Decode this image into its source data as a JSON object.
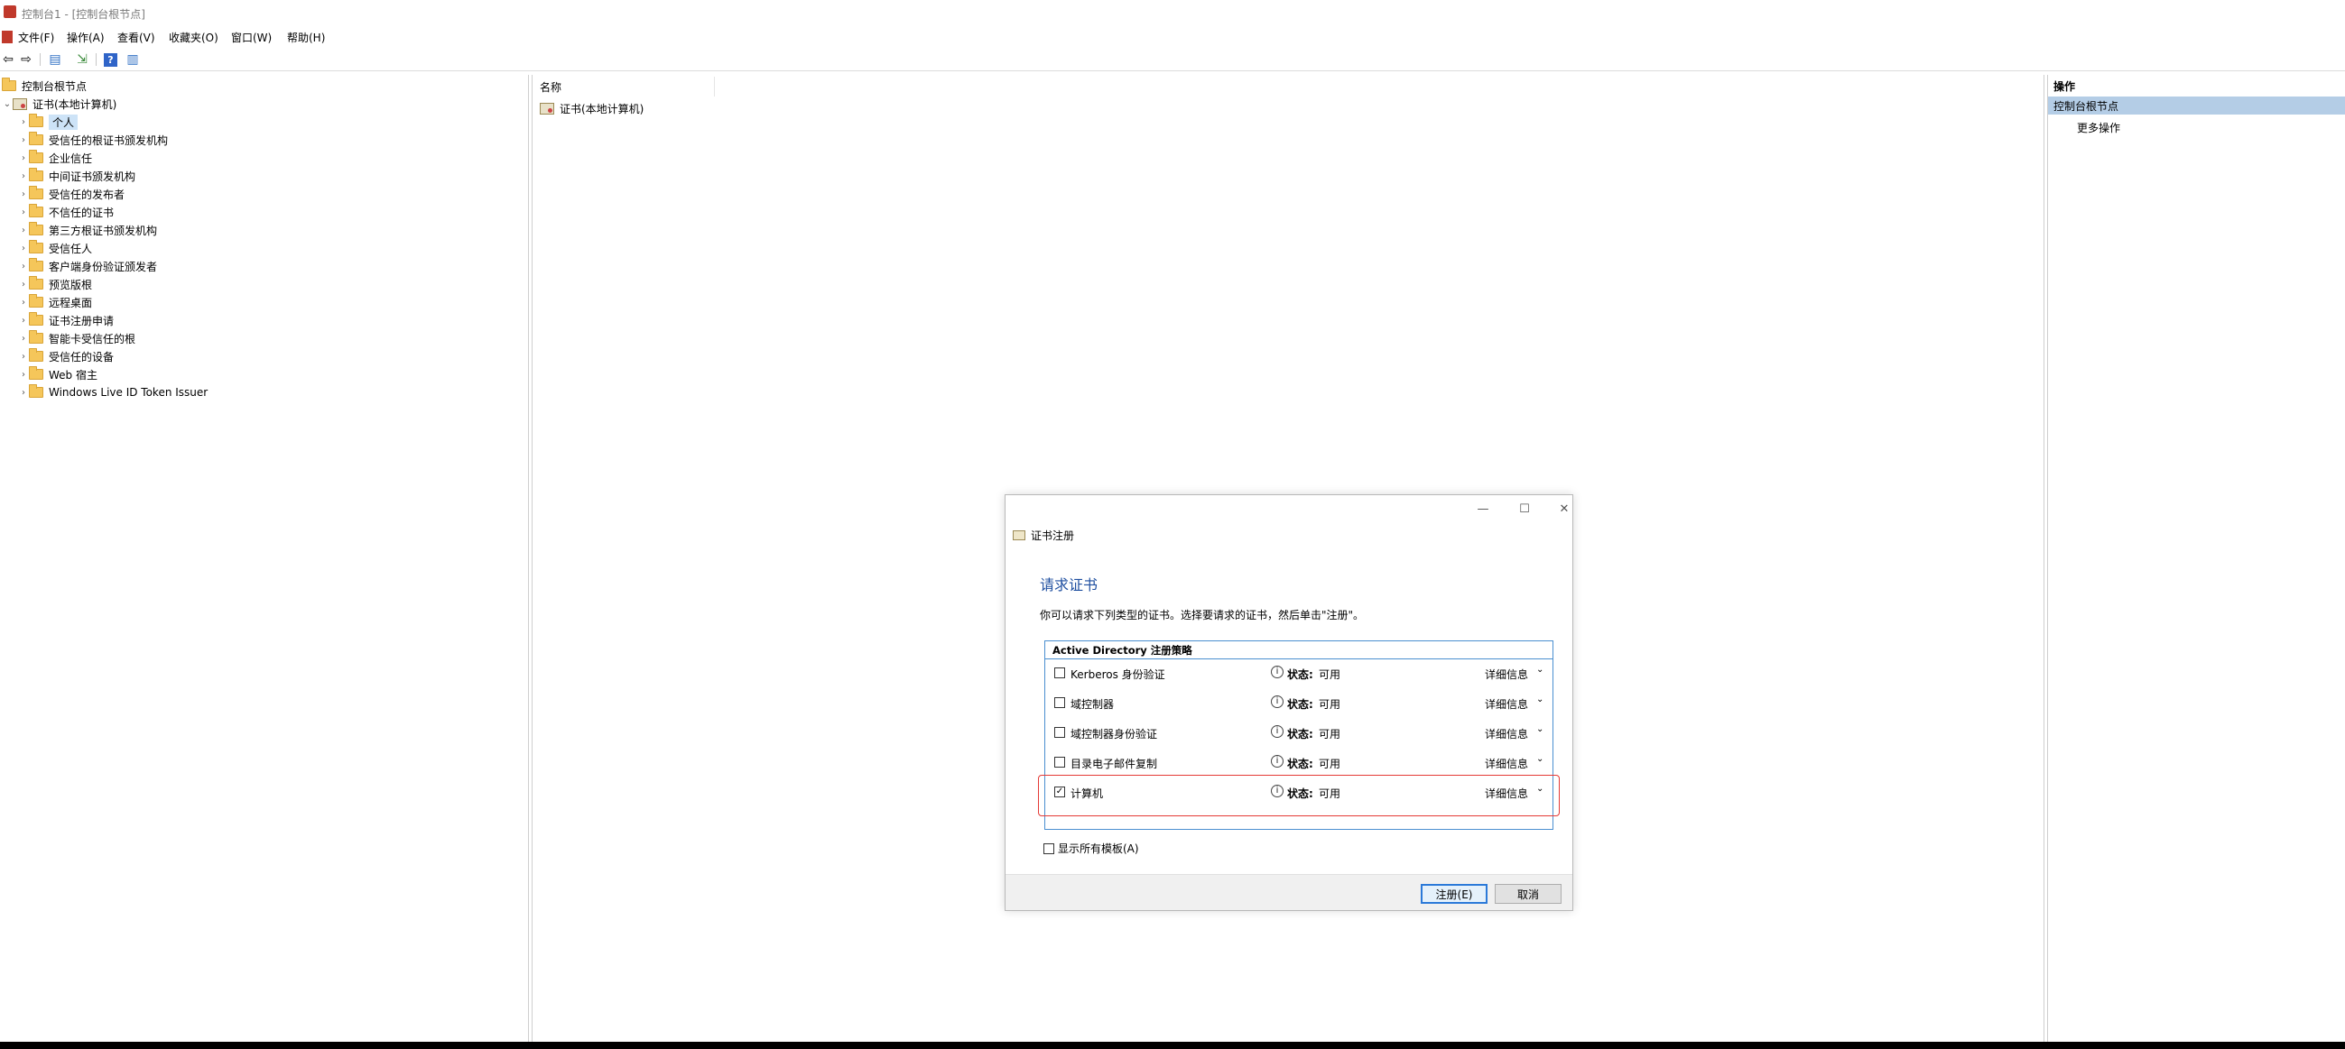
{
  "window": {
    "title": "控制台1 - [控制台根节点]"
  },
  "menu": [
    "文件(F)",
    "操作(A)",
    "查看(V)",
    "收藏夹(O)",
    "窗口(W)",
    "帮助(H)"
  ],
  "tree": {
    "root": "控制台根节点",
    "cert_root": "证书(本地计算机)",
    "items": [
      "个人",
      "受信任的根证书颁发机构",
      "企业信任",
      "中间证书颁发机构",
      "受信任的发布者",
      "不信任的证书",
      "第三方根证书颁发机构",
      "受信任人",
      "客户端身份验证颁发者",
      "预览版根",
      "远程桌面",
      "证书注册申请",
      "智能卡受信任的根",
      "受信任的设备",
      "Web 宿主",
      "Windows Live ID Token Issuer"
    ]
  },
  "center": {
    "column_name": "名称",
    "item": "证书(本地计算机)"
  },
  "actions": {
    "header": "操作",
    "section": "控制台根节点",
    "more": "更多操作"
  },
  "dialog": {
    "title": "证书注册",
    "heading": "请求证书",
    "description": "你可以请求下列类型的证书。选择要请求的证书，然后单击\"注册\"。",
    "policy_header": "Active Directory 注册策略",
    "status_label": "状态:",
    "detail_label": "详细信息",
    "rows": [
      {
        "name": "Kerberos 身份验证",
        "status": "可用",
        "checked": false
      },
      {
        "name": "域控制器",
        "status": "可用",
        "checked": false
      },
      {
        "name": "域控制器身份验证",
        "status": "可用",
        "checked": false
      },
      {
        "name": "目录电子邮件复制",
        "status": "可用",
        "checked": false
      },
      {
        "name": "计算机",
        "status": "可用",
        "checked": true
      }
    ],
    "show_all": "显示所有模板(A)",
    "enroll_button": "注册(E)",
    "cancel_button": "取消"
  }
}
